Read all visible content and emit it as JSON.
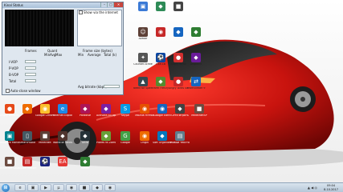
{
  "window": {
    "title": "Kinal Status",
    "checkbox_show": "Show via the internet",
    "col_frames": "Frames",
    "col_quant": "Quant",
    "col_min": "Min",
    "col_avg": "Avg",
    "col_max": "Max",
    "col_frame_size": "Frame size (bytes)",
    "col_fs_min": "Min",
    "col_fs_avg": "Average",
    "col_fs_total": "Total (k)",
    "row_ivop": "I-VOP",
    "row_pvop": "P-VOP",
    "row_bvop": "B-VOP",
    "row_total": "Total",
    "avg_bitrate": "Avg bitrate (kbps)",
    "auto_close": "Auto-close window",
    "min_btn": "–",
    "max_btn": "□",
    "close_btn": "✕"
  },
  "desktop_icons": [
    {
      "caption": "",
      "color": "#3b7ad6",
      "glyph": "▣"
    },
    {
      "caption": "",
      "color": "#2e8b57",
      "glyph": "◆"
    },
    {
      "caption": "",
      "color": "#444444",
      "glyph": "■"
    },
    {
      "caption": "Avatar",
      "color": "#5d4037",
      "glyph": "☺"
    },
    {
      "caption": "",
      "color": "#c62828",
      "glyph": "◉"
    },
    {
      "caption": "",
      "color": "#1565c0",
      "glyph": "◆"
    },
    {
      "caption": "",
      "color": "#2e7d32",
      "glyph": "◆"
    },
    {
      "caption": "Counter-Strike",
      "color": "#555555",
      "glyph": "✦"
    },
    {
      "caption": "FIFA 16",
      "color": "#0d47a1",
      "glyph": "⚽"
    },
    {
      "caption": "Angry Birds",
      "color": "#d32f2f",
      "glyph": "●"
    },
    {
      "caption": "Dispatch",
      "color": "#6a1b9a",
      "glyph": "◆"
    },
    {
      "caption": "Need for Speed",
      "color": "#37474f",
      "glyph": "▲"
    },
    {
      "caption": "Farm Frenzy",
      "color": "#558b2f",
      "glyph": "◆"
    },
    {
      "caption": "Angry Birds Seasons",
      "color": "#c62828",
      "glyph": "●"
    },
    {
      "caption": "TeamViewer 9",
      "color": "#1565c0",
      "glyph": "⇄"
    },
    {
      "caption": "Angry Birds Rio",
      "color": "#e64a19",
      "glyph": "●"
    },
    {
      "caption": "",
      "color": "#ef6c00",
      "glyph": "◆"
    },
    {
      "caption": "Google Chrome",
      "color": "#fbc02d",
      "glyph": "◉"
    },
    {
      "caption": "Internet Explorer",
      "color": "#1e88e5",
      "glyph": "e"
    },
    {
      "caption": "Paradise",
      "color": "#ad1457",
      "glyph": "◆"
    },
    {
      "caption": "Activate All Apps",
      "color": "#7b1fa2",
      "glyph": "◆"
    },
    {
      "caption": "Skype",
      "color": "#039be5",
      "glyph": "S"
    },
    {
      "caption": "Mozilla Firefox",
      "color": "#e65100",
      "glyph": "◉"
    },
    {
      "caption": "Google Earth",
      "color": "#1565c0",
      "glyph": "◉"
    },
    {
      "caption": "Сети Играть",
      "color": "#424242",
      "glyph": "◆"
    },
    {
      "caption": "MinecraftSP",
      "color": "#6d4c41",
      "glyph": "■"
    },
    {
      "caption": "Network Monitor",
      "color": "#00838f",
      "glyph": "▣"
    },
    {
      "caption": "SmartPhone",
      "color": "#455a64",
      "glyph": "▯"
    },
    {
      "caption": "Minecraft",
      "color": "#5d4037",
      "glyph": "■"
    },
    {
      "caption": "World of Tanks",
      "color": "#4e342e",
      "glyph": "◆"
    },
    {
      "caption": "Ultra",
      "color": "#263238",
      "glyph": "◆"
    },
    {
      "caption": "Plants vs Zombies",
      "color": "#689f38",
      "glyph": "◆"
    },
    {
      "caption": "Google",
      "color": "#43a047",
      "glyph": "G"
    },
    {
      "caption": "Origin",
      "color": "#ef6c00",
      "glyph": "◉"
    },
    {
      "caption": "Soft Organizer",
      "color": "#0277bd",
      "glyph": "◆"
    },
    {
      "caption": "Новый текстовый",
      "color": "#607d8b",
      "glyph": "▤"
    },
    {
      "caption": "Minecraft Launcher",
      "color": "#6d4c41",
      "glyph": "■"
    },
    {
      "caption": "Adobe Reader",
      "color": "#c62828",
      "glyph": "▤"
    },
    {
      "caption": "FIFA 14",
      "color": "#1a237e",
      "glyph": "⚽"
    },
    {
      "caption": "EA",
      "color": "#e53935",
      "glyph": "EA"
    },
    {
      "caption": "Avatar",
      "color": "#2e7d32",
      "glyph": "◆"
    }
  ],
  "taskbar": {
    "start_glyph": "⊞",
    "time": "09:04",
    "date": "8.10.2017",
    "tray": "▲ ◀ ◎"
  }
}
